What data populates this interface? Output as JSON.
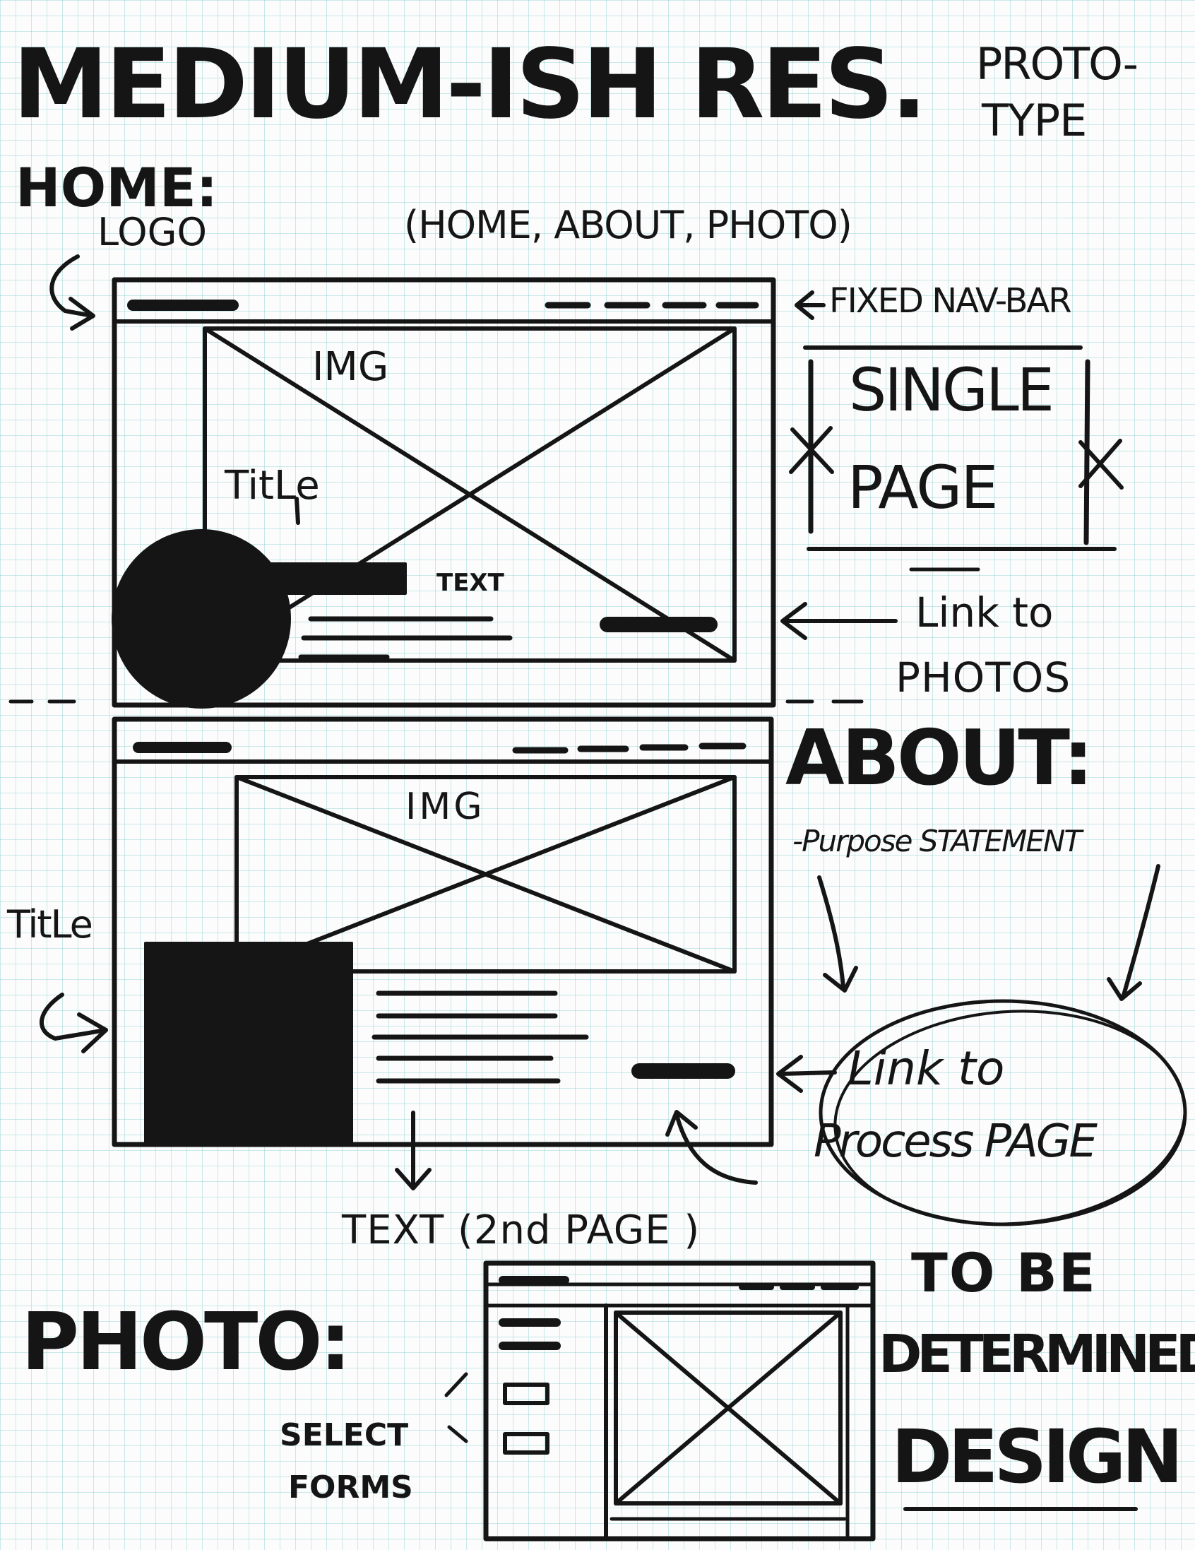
{
  "colors": {
    "ink": "#151515",
    "paper": "#fbfcfb",
    "grid": "#78c8cd"
  },
  "header": {
    "title": "MEDIUM-ISH RES.",
    "proto_line1": "PROTO-",
    "proto_line2": "TYPE"
  },
  "home": {
    "heading": "HOME:",
    "logo_label": "LOGO",
    "nav_items": "(HOME, ABOUT, PHOTO)",
    "fixed_nav_label": "FIXED NAV-BAR",
    "single_line1": "SINGLE",
    "single_line2": "PAGE",
    "img_label": "IMG",
    "title_label": "TitLe",
    "text_label": "TEXT",
    "link_line1": "Link to",
    "link_line2": "PHOTOS"
  },
  "about": {
    "heading": "ABOUT:",
    "purpose": "-Purpose STATEMENT",
    "img_label": "IMG",
    "title_label": "TitLe",
    "link_line1": "Link to",
    "link_line2": "Process PAGE",
    "text_second": "TEXT (2nd PAGE )"
  },
  "photo": {
    "heading": "PHOTO:",
    "select_line1": "SELECT",
    "select_line2": "FORMS",
    "tbd_line1": "TO BE",
    "tbd_line2": "DETERMINED",
    "tbd_line3": "DESIGN"
  }
}
